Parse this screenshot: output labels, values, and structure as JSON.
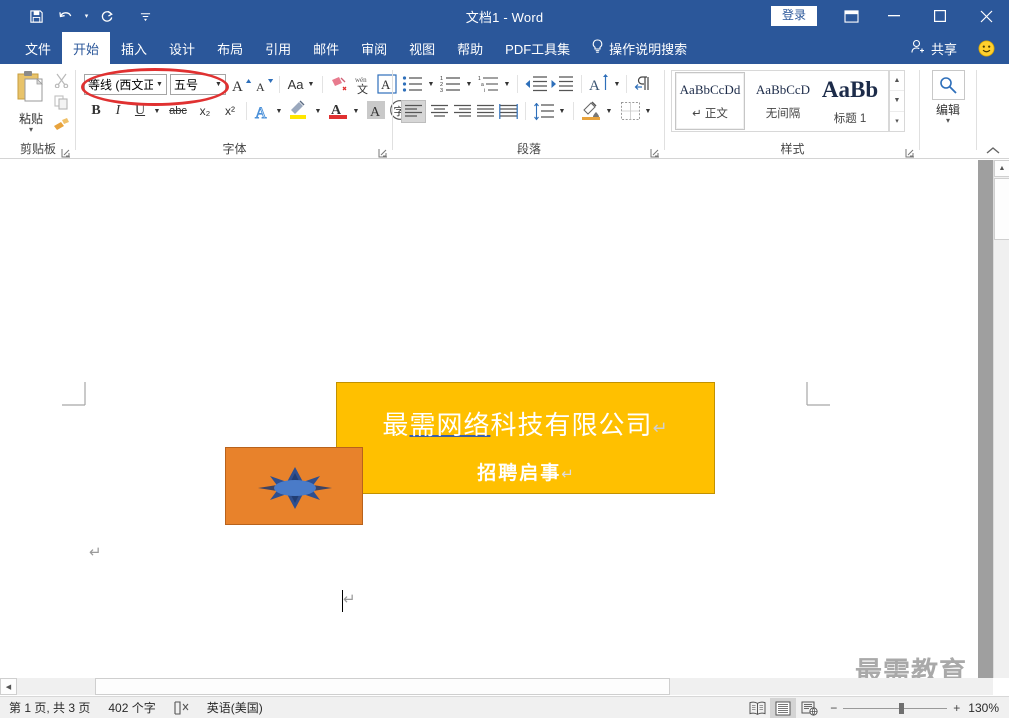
{
  "titlebar": {
    "title": "文档1  -  Word",
    "quick_access": [
      {
        "name": "save-icon",
        "label": "保存"
      },
      {
        "name": "undo-icon",
        "label": "撤消"
      },
      {
        "name": "redo-icon",
        "label": "恢复"
      },
      {
        "name": "customize-qat-icon",
        "label": "自定义快速访问工具栏"
      }
    ],
    "signin_label": "登录",
    "ribbon_display_label": "功能区显示选项",
    "minimize_label": "最小化",
    "maximize_label": "最大化",
    "close_label": "关闭"
  },
  "tabs": [
    {
      "label": "文件",
      "active": false
    },
    {
      "label": "开始",
      "active": true
    },
    {
      "label": "插入",
      "active": false
    },
    {
      "label": "设计",
      "active": false
    },
    {
      "label": "布局",
      "active": false
    },
    {
      "label": "引用",
      "active": false
    },
    {
      "label": "邮件",
      "active": false
    },
    {
      "label": "审阅",
      "active": false
    },
    {
      "label": "视图",
      "active": false
    },
    {
      "label": "帮助",
      "active": false
    },
    {
      "label": "PDF工具集",
      "active": false
    }
  ],
  "tellme": {
    "label": "操作说明搜索",
    "icon": "lightbulb-icon"
  },
  "share": {
    "label": "共享",
    "icon": "person-add-icon"
  },
  "ribbon": {
    "clipboard": {
      "group_label": "剪贴板",
      "paste_label": "粘贴",
      "cut_label": "剪切",
      "copy_label": "复制",
      "format_painter_label": "格式刷"
    },
    "font": {
      "group_label": "字体",
      "font_name": "等线 (西文正)",
      "font_size": "五号",
      "grow_font_label": "增大字号",
      "shrink_font_label": "减小字号",
      "change_case_label": "Aa",
      "phonetic_label": "拼音指南",
      "char_border_label": "字符边框",
      "clear_format_label": "清除所有格式",
      "bold_label": "B",
      "italic_label": "I",
      "underline_label": "U",
      "strikethrough_label": "abc",
      "subscript_label": "x₂",
      "superscript_label": "x²",
      "text_effects_label": "文本效果和版式",
      "highlight_label": "以不同颜色突出显示文本",
      "font_color_label": "字体颜色",
      "char_shading_label": "字符底纹",
      "enclose_char_label": "带圈字符"
    },
    "paragraph": {
      "group_label": "段落",
      "bullets_label": "项目符号",
      "numbering_label": "编号",
      "multilevel_label": "多级列表",
      "decrease_indent_label": "减少缩进量",
      "increase_indent_label": "增加缩进量",
      "sort_label": "排序",
      "show_marks_label": "显示/隐藏编辑标记",
      "align_left_label": "左对齐",
      "align_center_label": "居中",
      "align_right_label": "右对齐",
      "justify_label": "两端对齐",
      "distribute_label": "分散对齐",
      "line_spacing_label": "行和段落间距",
      "shading_label": "底纹",
      "borders_label": "边框"
    },
    "styles": {
      "group_label": "样式",
      "items": [
        {
          "preview": "AaBbCcDd",
          "name": "正文",
          "selected": true,
          "prefix": "↵"
        },
        {
          "preview": "AaBbCcD",
          "name": "无间隔",
          "selected": false,
          "prefix": ""
        },
        {
          "preview": "AaBb",
          "name": "标题 1",
          "selected": false,
          "prefix": ""
        }
      ],
      "scroll_up_label": "上一行",
      "scroll_down_label": "下一行",
      "more_label": "其他"
    },
    "editing": {
      "group_label": "编辑",
      "find_label": "编辑",
      "find_icon": "magnifier-icon"
    },
    "collapse_label": "折叠功能区"
  },
  "document": {
    "yellow_box": {
      "text_before": "最",
      "text_underlined": "需网络",
      "text_after": "科技有限公司",
      "return_mark": "↵",
      "subtitle": "招聘启事",
      "subtitle_return": "↵",
      "fill_color": "#ffc000",
      "border_color": "#c29100",
      "text_color": "#ffffff"
    },
    "orange_box": {
      "fill_color": "#e8822b",
      "border_color": "#b8621c",
      "shape_name": "6-point-star-shape",
      "shape_color": "#3b5ea8"
    },
    "paragraph_marks": [
      "↵",
      "↵"
    ],
    "watermark": "最需教育"
  },
  "statusbar": {
    "page_info": "第 1 页, 共 3 页",
    "word_count": "402 个字",
    "proofing_icon": "proofing-errors-icon",
    "language": "英语(美国)",
    "views": [
      {
        "name": "read-mode-icon",
        "label": "阅读视图",
        "active": false
      },
      {
        "name": "print-layout-icon",
        "label": "页面视图",
        "active": true
      },
      {
        "name": "web-layout-icon",
        "label": "Web 版式视图",
        "active": false
      }
    ],
    "zoom_out_label": "−",
    "zoom_in_label": "+",
    "zoom_level": "130%"
  }
}
